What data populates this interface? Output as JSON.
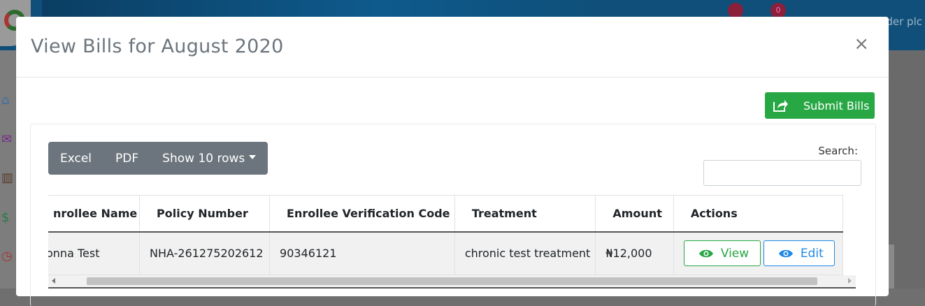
{
  "background": {
    "company_text": "der plc",
    "badge_1": "",
    "badge_2": "0"
  },
  "modal": {
    "title": "View Bills for August 2020",
    "close_label": "×",
    "submit_label": "Submit Bills"
  },
  "toolbar": {
    "excel_label": "Excel",
    "pdf_label": "PDF",
    "rows_label": "Show 10 rows"
  },
  "search": {
    "label": "Search:",
    "value": ""
  },
  "table": {
    "columns": [
      "nrollee Name",
      "Policy Number",
      "Enrollee Verification Code",
      "Treatment",
      "Amount",
      "Actions"
    ],
    "rows": [
      {
        "name": "onna Test",
        "policy": "NHA-261275202612",
        "code": "90346121",
        "treatment": "chronic test treatment",
        "amount": "₦12,000",
        "view_label": "View",
        "edit_label": "Edit"
      }
    ]
  },
  "colors": {
    "success": "#28a745",
    "primary": "#1e88e5",
    "secondary": "#6c757d"
  }
}
